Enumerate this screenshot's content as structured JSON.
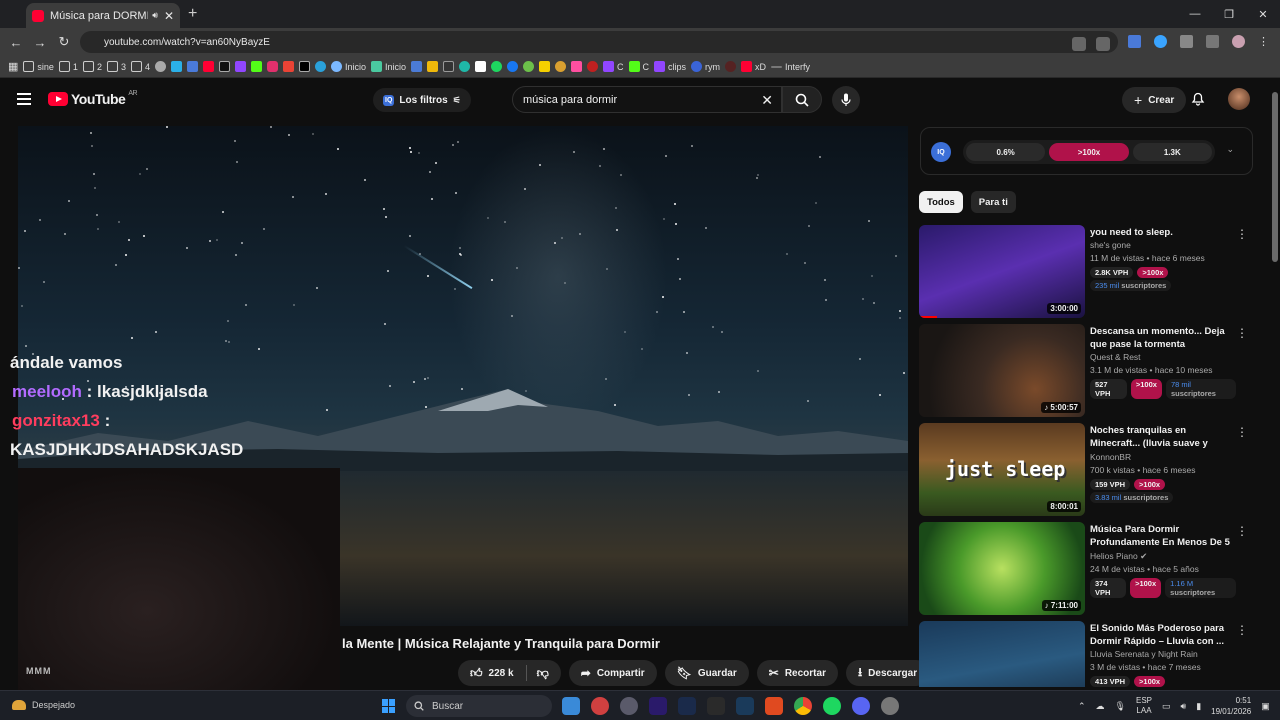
{
  "browser": {
    "tab_title": "Música para DORMIR PROF",
    "url": "youtube.com/watch?v=an60NyBayzE",
    "bookmarks": [
      {
        "label": "sine",
        "icon": "folder-icon"
      },
      {
        "label": "1",
        "icon": "folder-icon"
      },
      {
        "label": "2",
        "icon": "folder-icon"
      },
      {
        "label": "3",
        "icon": "folder-icon"
      },
      {
        "label": "4",
        "icon": "folder-icon"
      },
      {
        "label": "Inicio",
        "icon": "site-icon"
      },
      {
        "label": "Inicio",
        "icon": "site-icon"
      },
      {
        "label": "C",
        "icon": "twitch-icon"
      },
      {
        "label": "C",
        "icon": "kick-icon"
      },
      {
        "label": "clips",
        "icon": "twitch-icon"
      },
      {
        "label": "rym",
        "icon": "site-icon"
      },
      {
        "label": "xD",
        "icon": "youtube-icon"
      },
      {
        "label": "Interfy",
        "icon": "site-icon"
      }
    ]
  },
  "header": {
    "logo_text": "YouTube",
    "region": "AR",
    "filters_label": "Los filtros",
    "search_value": "música para dormir",
    "create_label": "Crear"
  },
  "player": {
    "chat": [
      {
        "user": "",
        "msg": "ándale vamos",
        "color": "#ffffff"
      },
      {
        "user": "meelooh",
        "msg": " : lkasjdkljalsda",
        "color": "#b26bff"
      },
      {
        "user": "gonzitax13",
        "msg": " :",
        "color": "#ff3d5e"
      },
      {
        "user": "",
        "msg": "KASJDHKJDSAHADSKJASD",
        "color": "#ffffff"
      }
    ],
    "cam_logo": "MMM"
  },
  "video": {
    "title": "la Mente | Música Relajante y Tranquila para Dormir",
    "likes": "228 k",
    "share": "Compartir",
    "save": "Guardar",
    "clip": "Recortar",
    "download": "Descargar"
  },
  "iq_panel": {
    "badge": "IQ",
    "values": [
      "0.6%",
      ">100x",
      "1.3K"
    ]
  },
  "chips": [
    "Todos",
    "Para ti"
  ],
  "recommendations": [
    {
      "title": "you need to sleep.",
      "channel": "she's gone",
      "views": "11 M de vistas • hace 6 meses",
      "vph": "2.8K VPH",
      "mult": ">100x",
      "subs_num": "235 mil",
      "subs_label": " suscriptores",
      "duration": "3:00:00",
      "has_progress": true,
      "theme": "purple"
    },
    {
      "title": "Descansa un momento... Deja que pase la tormenta",
      "channel": "Quest & Rest",
      "views": "3.1 M de vistas • hace 10 meses",
      "vph": "527 VPH",
      "mult": ">100x",
      "subs_num": "78 mil",
      "subs_label": " suscriptores",
      "duration": "5:00:57",
      "has_progress": false,
      "theme": "cave"
    },
    {
      "title": "Noches tranquilas en Minecraft... (lluvia suave y música pacífica)",
      "channel": "KonnonBR",
      "views": "700 k vistas • hace 6 meses",
      "vph": "159 VPH",
      "mult": ">100x",
      "subs_num": "3.83 mil",
      "subs_label": " suscriptores",
      "duration": "8:00:01",
      "has_progress": false,
      "theme": "minecraft",
      "overlay": "just sleep"
    },
    {
      "title": "Música Para Dormir Profundamente En Menos De 5 ...",
      "channel": "Helios Piano",
      "views": "24 M de vistas • hace 5 años",
      "vph": "374 VPH",
      "mult": ">100x",
      "subs_num": "1.16 M",
      "subs_label": " suscriptores",
      "duration": "7:11:00",
      "has_progress": false,
      "theme": "green"
    },
    {
      "title": "El Sonido Más Poderoso para Dormir Rápido – Lluvia con ...",
      "channel": "Lluvia Serenata y Night Rain",
      "views": "3 M de vistas • hace 7 meses",
      "vph": "413 VPH",
      "mult": ">100x",
      "subs_num": "",
      "subs_label": "",
      "duration": "",
      "has_progress": false,
      "theme": "storm"
    }
  ],
  "taskbar": {
    "weather": "Despejado",
    "search": "Buscar",
    "lang_top": "ESP",
    "lang_bottom": "LAA",
    "time": "0:51",
    "date": "19/01/2026"
  }
}
